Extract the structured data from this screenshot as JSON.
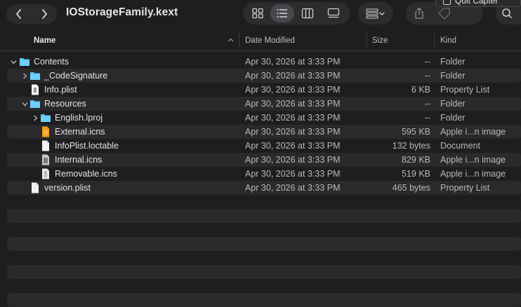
{
  "window": {
    "title": "IOStorageFamily.kext"
  },
  "tooltip": {
    "label": "Quit Capter"
  },
  "columns": {
    "name": "Name",
    "date": "Date Modified",
    "size": "Size",
    "kind": "Kind"
  },
  "rows": [
    {
      "name": "Contents",
      "date": "Apr 30, 2026 at 3:33 PM",
      "size": "--",
      "kind": "Folder"
    },
    {
      "name": "_CodeSignature",
      "date": "Apr 30, 2026 at 3:33 PM",
      "size": "--",
      "kind": "Folder"
    },
    {
      "name": "Info.plist",
      "date": "Apr 30, 2026 at 3:33 PM",
      "size": "6 KB",
      "kind": "Property List"
    },
    {
      "name": "Resources",
      "date": "Apr 30, 2026 at 3:33 PM",
      "size": "--",
      "kind": "Folder"
    },
    {
      "name": "English.lproj",
      "date": "Apr 30, 2026 at 3:33 PM",
      "size": "--",
      "kind": "Folder"
    },
    {
      "name": "External.icns",
      "date": "Apr 30, 2026 at 3:33 PM",
      "size": "595 KB",
      "kind": "Apple i...n image"
    },
    {
      "name": "InfoPlist.loctable",
      "date": "Apr 30, 2026 at 3:33 PM",
      "size": "132 bytes",
      "kind": "Document"
    },
    {
      "name": "Internal.icns",
      "date": "Apr 30, 2026 at 3:33 PM",
      "size": "829 KB",
      "kind": "Apple i...n image"
    },
    {
      "name": "Removable.icns",
      "date": "Apr 30, 2026 at 3:33 PM",
      "size": "519 KB",
      "kind": "Apple i...n image"
    },
    {
      "name": "version.plist",
      "date": "Apr 30, 2026 at 3:33 PM",
      "size": "465 bytes",
      "kind": "Property List"
    }
  ],
  "colors": {
    "folder": "#5ac8fa",
    "background": "#1e1e20",
    "alt_row": "#2a2a2c"
  }
}
